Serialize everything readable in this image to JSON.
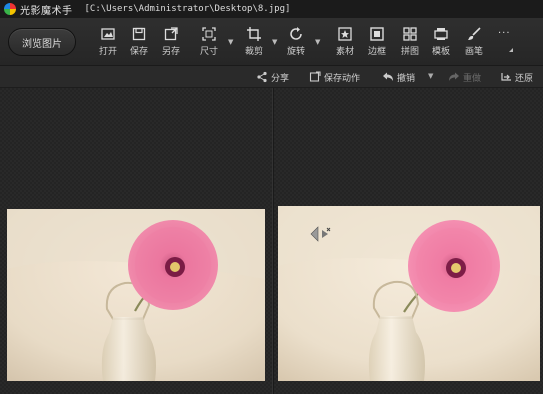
{
  "title_bar": {
    "app_name": "光影魔术手",
    "file_path": "[C:\\Users\\Administrator\\Desktop\\8.jpg]",
    "logo_icon": "app-logo-icon"
  },
  "toolbar": {
    "browse_label": "浏览图片",
    "tools": [
      {
        "label": "打开",
        "icon": "open-icon"
      },
      {
        "label": "保存",
        "icon": "save-icon"
      },
      {
        "label": "另存",
        "icon": "save-as-icon"
      },
      {
        "label": "尺寸",
        "icon": "resize-icon"
      },
      {
        "label": "裁剪",
        "icon": "crop-icon"
      },
      {
        "label": "旋转",
        "icon": "rotate-icon"
      },
      {
        "label": "素材",
        "icon": "material-icon"
      },
      {
        "label": "边框",
        "icon": "border-icon"
      },
      {
        "label": "拼图",
        "icon": "collage-icon"
      },
      {
        "label": "模板",
        "icon": "template-icon"
      },
      {
        "label": "画笔",
        "icon": "brush-icon"
      }
    ],
    "more_label": "···"
  },
  "actions": {
    "share": "分享",
    "save_action": "保存动作",
    "undo": "撤销",
    "redo": "重做",
    "restore": "还原"
  },
  "colors": {
    "accent_logo": [
      "#e33333",
      "#f4c400",
      "#39b54a",
      "#1e88e5"
    ],
    "background": "#242424",
    "toolbar": "#2b2b2b",
    "flower": "#e86a8e"
  }
}
